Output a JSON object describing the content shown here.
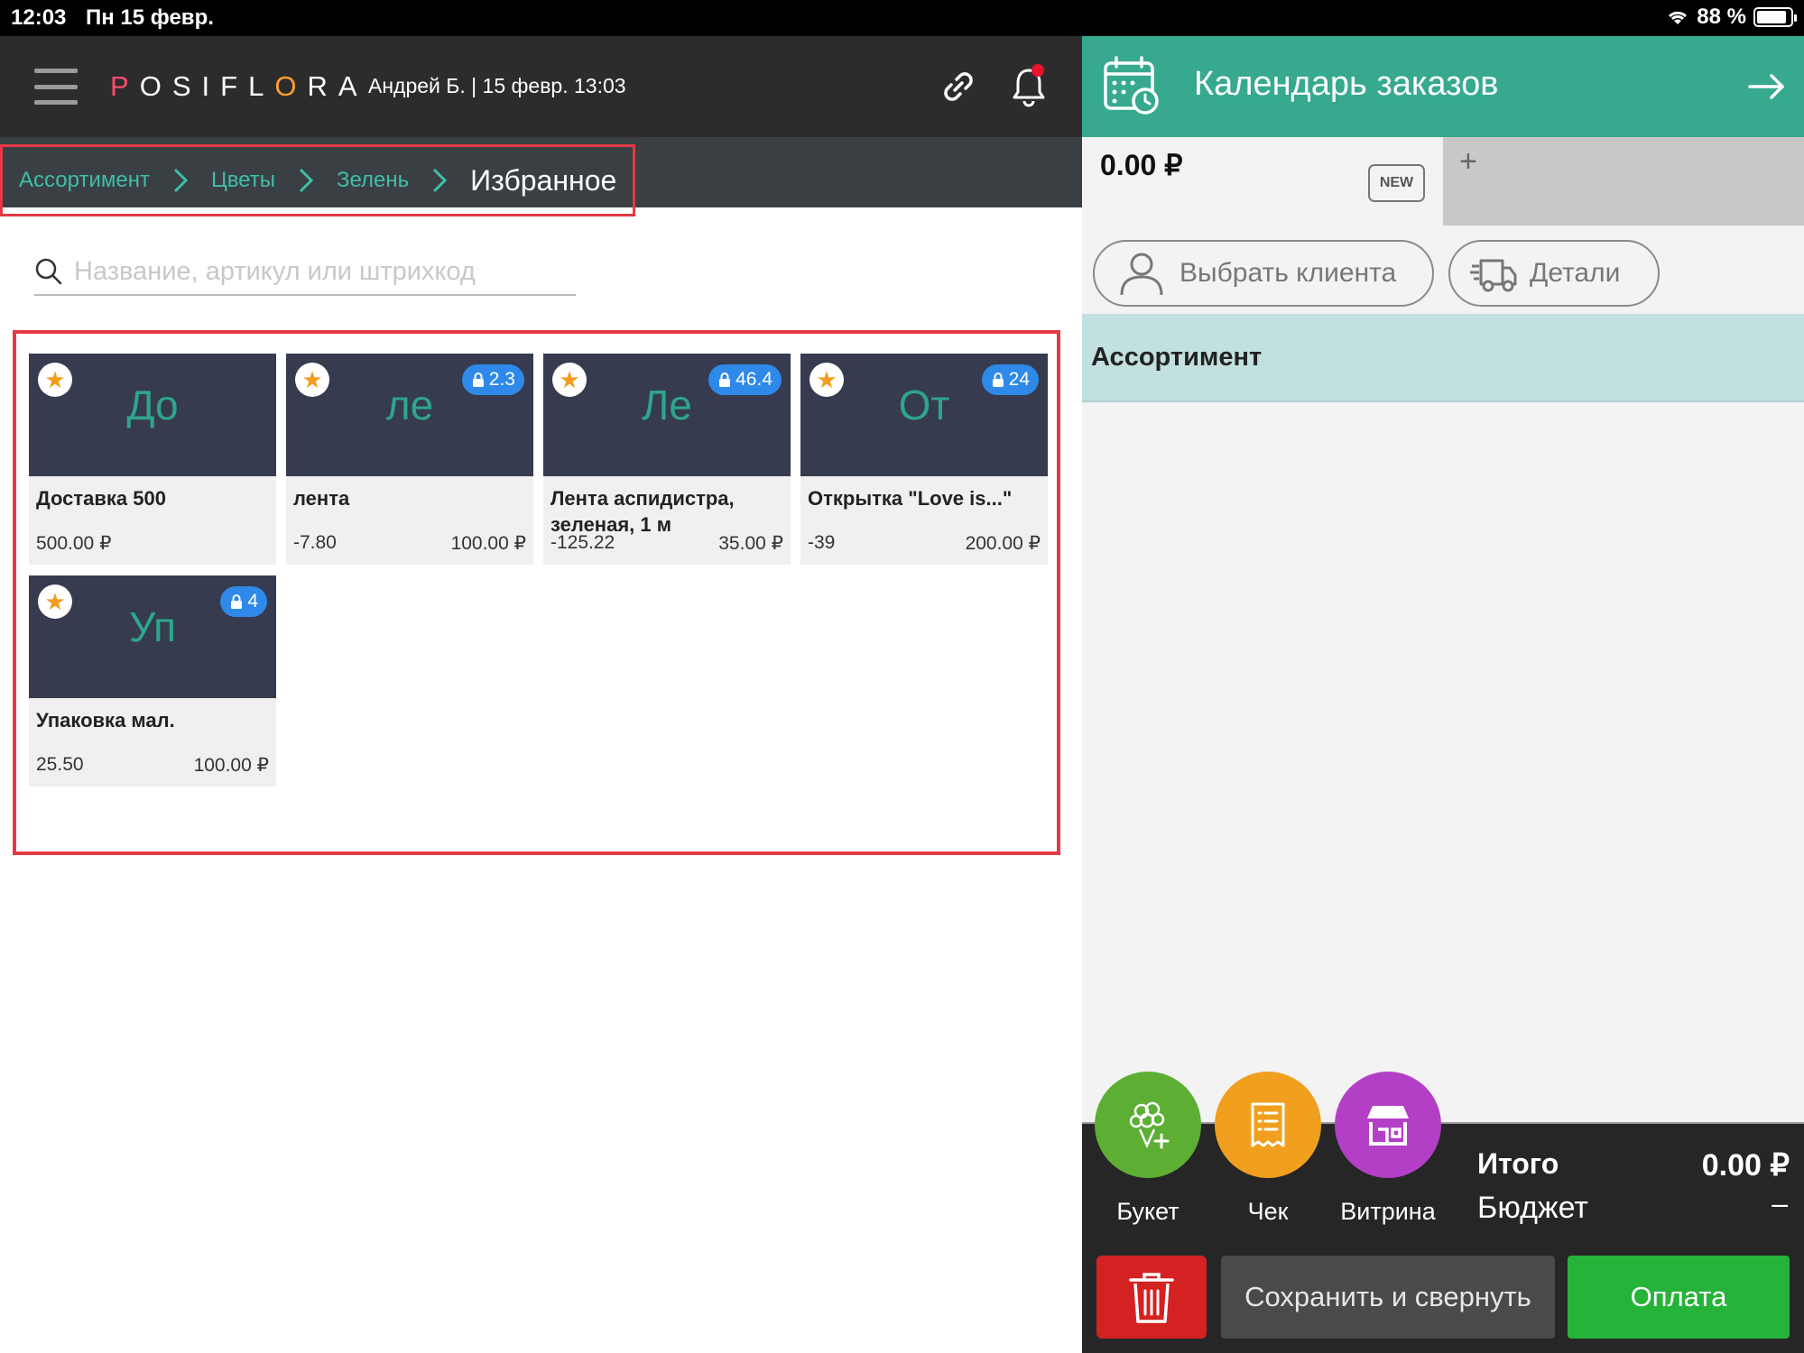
{
  "status_bar": {
    "time": "12:03",
    "date": "Пн 15 февр.",
    "battery_text": "88 %",
    "battery_level": 0.88
  },
  "header": {
    "logo": "POSIFLORA",
    "user_info": "Андрей Б.  | 15 февр. 13:03",
    "menu_icon": "hamburger-icon",
    "link_icon": "link-icon",
    "bell_icon": "bell-icon",
    "has_notification": true
  },
  "breadcrumb": {
    "items": [
      "Ассортимент",
      "Цветы",
      "Зелень"
    ],
    "current": "Избранное"
  },
  "search": {
    "placeholder": "Название, артикул или штрихкод",
    "value": ""
  },
  "products": [
    {
      "abbr": "До",
      "name": "Доставка 500",
      "stock": "500.00 ₽",
      "price": "",
      "badge": "",
      "favorite": true
    },
    {
      "abbr": "ле",
      "name": "лента",
      "stock": "-7.80",
      "price": "100.00 ₽",
      "badge": "2.3",
      "favorite": true
    },
    {
      "abbr": "Ле",
      "name": "Лента аспидистра, зеленая, 1 м",
      "stock": "-125.22",
      "price": "35.00 ₽",
      "badge": "46.4",
      "favorite": true
    },
    {
      "abbr": "От",
      "name": "Открытка  \"Love is...\"",
      "stock": "-39",
      "price": "200.00 ₽",
      "badge": "24",
      "favorite": true
    },
    {
      "abbr": "Уп",
      "name": "Упаковка мал.",
      "stock": "25.50",
      "price": "100.00 ₽",
      "badge": "4",
      "favorite": true
    }
  ],
  "right_panel": {
    "title": "Календарь заказов",
    "calendar_icon": "calendar-clock-icon",
    "arrow_icon": "arrow-right-icon",
    "order_tab": {
      "amount": "0.00 ₽",
      "badge": "NEW"
    },
    "add_tab": "+",
    "client_button": "Выбрать клиента",
    "details_button": "Детали",
    "section_title": "Ассортимент",
    "actions": [
      {
        "label": "Букет",
        "icon": "bouquet-icon",
        "color": "#5daf34"
      },
      {
        "label": "Чек",
        "icon": "receipt-icon",
        "color": "#f0a01e"
      },
      {
        "label": "Витрина",
        "icon": "storefront-icon",
        "color": "#b43fc7"
      }
    ],
    "total_label": "Итого",
    "total_value": "0.00 ₽",
    "budget_label": "Бюджет",
    "budget_value": "–",
    "delete_icon": "trash-icon",
    "save_button": "Сохранить и свернуть",
    "pay_button": "Оплата"
  },
  "colors": {
    "accent_teal": "#36a98e",
    "highlight_red": "#e53945",
    "pay_green": "#26b33a",
    "delete_red": "#d42122",
    "badge_blue": "#2e89e8",
    "star_orange": "#f29d1e"
  }
}
